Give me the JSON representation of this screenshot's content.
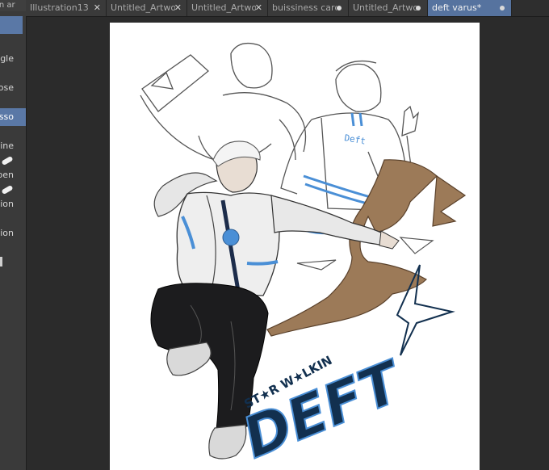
{
  "window": {
    "panel_title": "tion ar"
  },
  "tools": [
    {
      "label": "gle",
      "active": false
    },
    {
      "label": "ose",
      "active": false
    },
    {
      "label": "sso",
      "active": true
    },
    {
      "label": "ine",
      "active": false
    },
    {
      "label": "pen",
      "active": false
    },
    {
      "label": "tion",
      "active": false
    },
    {
      "label": "tion",
      "active": false
    }
  ],
  "tabs": [
    {
      "label": "Illustration13",
      "control": "close",
      "active": false
    },
    {
      "label": "Untitled_Artwork",
      "control": "close",
      "active": false
    },
    {
      "label": "Untitled_Artwork",
      "control": "close",
      "active": false
    },
    {
      "label": "buissiness card*",
      "control": "dot",
      "active": false
    },
    {
      "label": "Untitled_Artwork",
      "control": "dot",
      "active": false
    },
    {
      "label": "deft varus*",
      "control": "dot",
      "active": true
    }
  ],
  "icons": {
    "close": "close-icon",
    "dot": "unsaved-dot-icon"
  },
  "artwork": {
    "jacket_text": "Deft",
    "lettering": "ST★R W★LKIN",
    "logo_text": "DEFT",
    "colors": {
      "accent_blue": "#4a8fd6",
      "navy": "#12304f",
      "wing_brown": "#9c7a58",
      "tab_active": "#56739f"
    }
  }
}
